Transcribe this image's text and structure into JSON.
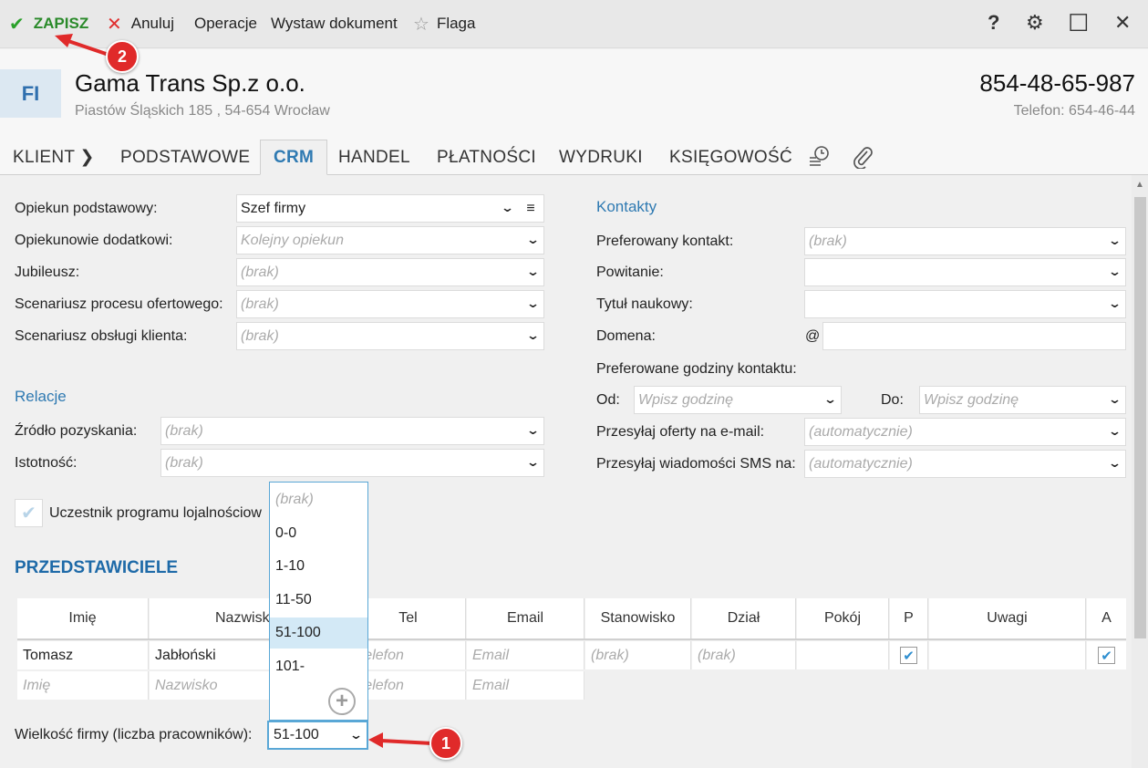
{
  "toolbar": {
    "save_label": "ZAPISZ",
    "cancel_label": "Anuluj",
    "operations_label": "Operacje",
    "issue_document_label": "Wystaw dokument",
    "flag_label": "Flaga",
    "help_symbol": "?",
    "gear_symbol": "⚙",
    "maximize_symbol": "☐",
    "close_symbol": "✕"
  },
  "header": {
    "badge": "FI",
    "company_name": "Gama Trans Sp.z o.o.",
    "address": "Piastów Śląskich 185 , 54-654 Wrocław",
    "nip": "854-48-65-987",
    "phone": "Telefon: 654-46-44"
  },
  "tabs": [
    {
      "label": "KLIENT ❯"
    },
    {
      "label": "PODSTAWOWE"
    },
    {
      "label": "CRM"
    },
    {
      "label": "HANDEL"
    },
    {
      "label": "PŁATNOŚCI"
    },
    {
      "label": "WYDRUKI"
    },
    {
      "label": "KSIĘGOWOŚĆ"
    }
  ],
  "tab_icons": [
    "history-icon",
    "paperclip-icon"
  ],
  "left_form": {
    "primary_keeper_label": "Opiekun podstawowy:",
    "primary_keeper_value": "Szef firmy",
    "additional_keepers_label": "Opiekunowie dodatkowi:",
    "additional_keepers_placeholder": "Kolejny opiekun",
    "jubilee_label": "Jubileusz:",
    "jubilee_value": "(brak)",
    "offer_scenario_label": "Scenariusz procesu ofertowego:",
    "offer_scenario_value": "(brak)",
    "service_scenario_label": "Scenariusz obsługi klienta:",
    "service_scenario_value": "(brak)"
  },
  "relations": {
    "title": "Relacje",
    "source_label": "Źródło pozyskania:",
    "source_value": "(brak)",
    "importance_label": "Istotność:",
    "importance_value": "(brak)"
  },
  "loyalty": {
    "label": "Uczestnik programu lojalnościow",
    "checked": true
  },
  "contacts": {
    "title": "Kontakty",
    "preferred_contact_label": "Preferowany kontakt:",
    "preferred_contact_value": "(brak)",
    "greeting_label": "Powitanie:",
    "greeting_value": "",
    "academic_title_label": "Tytuł naukowy:",
    "academic_title_value": "",
    "domain_label": "Domena:",
    "domain_at": "@",
    "domain_value": "",
    "hours_label": "Preferowane godziny kontaktu:",
    "from_label": "Od:",
    "from_placeholder": "Wpisz godzinę",
    "to_label": "Do:",
    "to_placeholder": "Wpisz godzinę",
    "offers_email_label": "Przesyłaj oferty na e-mail:",
    "offers_email_value": "(automatycznie)",
    "sms_label": "Przesyłaj wiadomości SMS na:",
    "sms_value": "(automatycznie)"
  },
  "representatives": {
    "title": "PRZEDSTAWICIELE",
    "columns": [
      "Imię",
      "Nazwisko",
      "Tel",
      "Email",
      "Stanowisko",
      "Dział",
      "Pokój",
      "P",
      "Uwagi",
      "A"
    ],
    "row1": {
      "first_name": "Tomasz",
      "last_name": "Jabłoński",
      "tel": "Telefon",
      "email": "Email",
      "position": "(brak)",
      "department": "(brak)",
      "p_checked": true,
      "a_checked": true
    },
    "new_row": {
      "first_name": "Imię",
      "last_name": "Nazwisko",
      "tel": "Telefon",
      "email": "Email"
    }
  },
  "company_size": {
    "label": "Wielkość firmy (liczba pracowników):",
    "value": "51-100",
    "options": [
      "(brak)",
      "0-0",
      "1-10",
      "11-50",
      "51-100",
      "101-"
    ],
    "selected_index": 4
  },
  "annotations": {
    "badge_1": "1",
    "badge_2": "2"
  },
  "colors": {
    "accent": "#2f7ab2",
    "save_green": "#2aa12a",
    "cancel_red": "#e03030",
    "annotation_red": "#e02a2a",
    "selected_bg": "#d3e9f6"
  }
}
